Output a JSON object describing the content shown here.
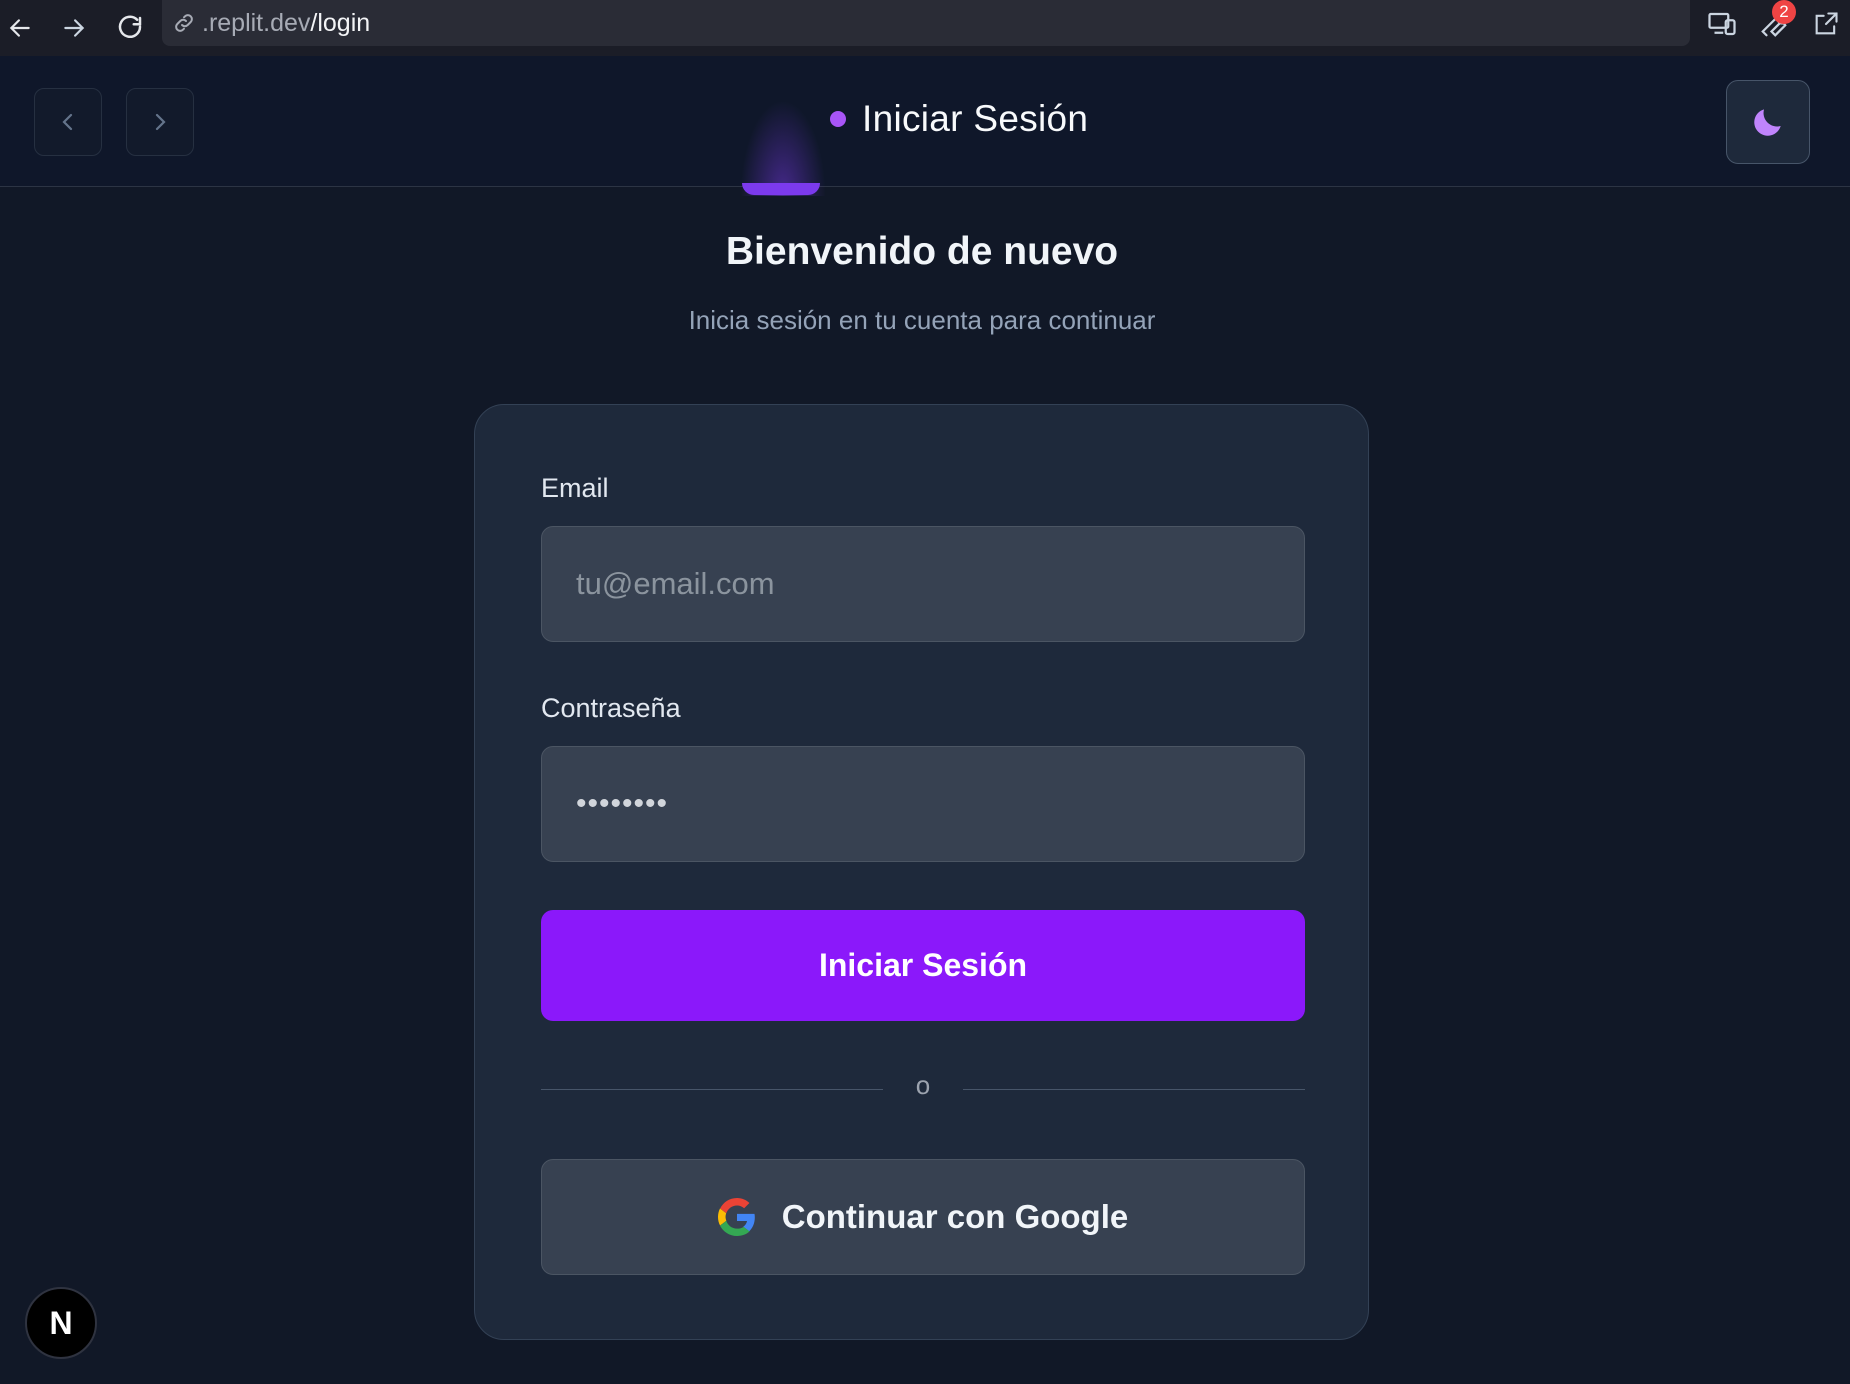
{
  "browser": {
    "url_domain": ".replit.dev",
    "url_path": "/login",
    "notification_count": "2"
  },
  "header": {
    "title": "Iniciar Sesión",
    "accent_color": "#a855f7"
  },
  "page": {
    "heading": "Bienvenido de nuevo",
    "subheading": "Inicia sesión en tu cuenta para continuar"
  },
  "form": {
    "email_label": "Email",
    "email_placeholder": "tu@email.com",
    "password_label": "Contraseña",
    "password_value": "••••••••",
    "submit_label": "Iniciar Sesión",
    "divider_text": "o",
    "google_label": "Continuar con Google",
    "primary_color": "#8b18fa"
  },
  "dev_badge": {
    "letter": "N"
  }
}
